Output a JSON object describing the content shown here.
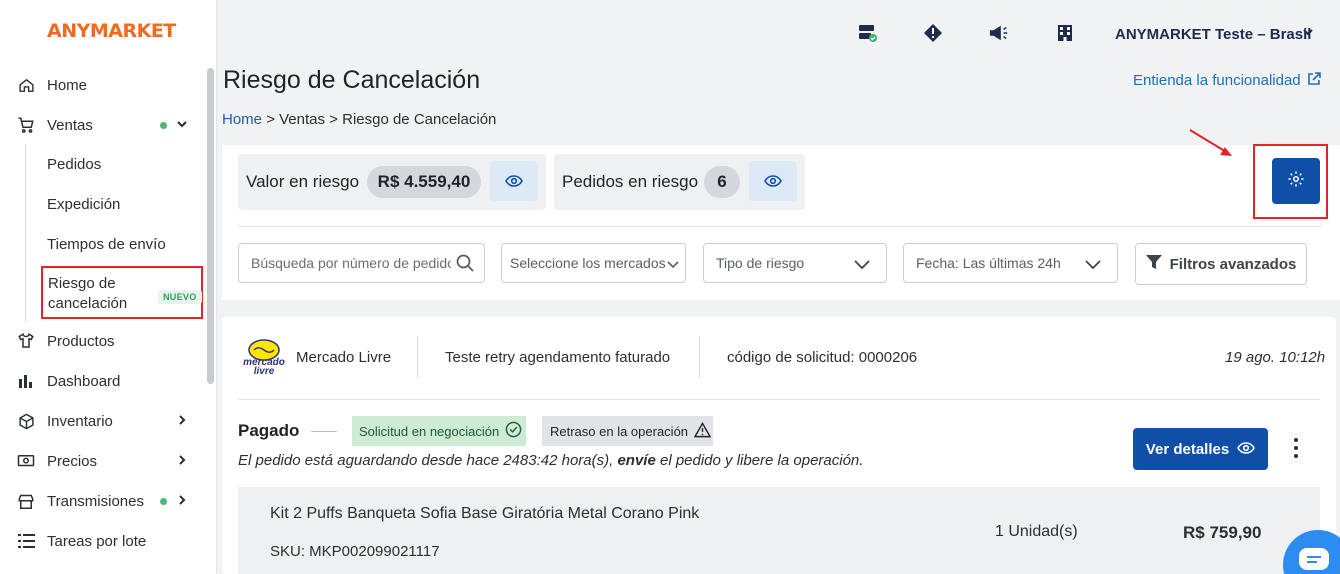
{
  "app": {
    "logo": "ANYMARKET"
  },
  "sidebar": {
    "items": [
      {
        "label": "Home",
        "icon": "home-icon"
      },
      {
        "label": "Ventas",
        "icon": "cart-icon",
        "expanded": true
      },
      {
        "label": "Productos",
        "icon": "shirt-icon"
      },
      {
        "label": "Dashboard",
        "icon": "bar-chart-icon"
      },
      {
        "label": "Inventario",
        "icon": "box-icon"
      },
      {
        "label": "Precios",
        "icon": "money-icon"
      },
      {
        "label": "Transmisiones",
        "icon": "store-icon"
      },
      {
        "label": "Tareas por lote",
        "icon": "list-icon"
      }
    ],
    "ventas_sub": [
      "Pedidos",
      "Expedición",
      "Tiempos de envío",
      "Riesgo de cancelación"
    ],
    "nuevo_badge": "NUEVO"
  },
  "topbar": {
    "icons": [
      "server-check-icon",
      "warning-diamond-icon",
      "megaphone-icon",
      "building-icon"
    ],
    "account": "ANYMARKET Teste – Brasil"
  },
  "header": {
    "title": "Riesgo de Cancelación",
    "help_link": "Entienda la funcionalidad",
    "breadcrumb": {
      "home": "Home",
      "sep": ">",
      "section": "Ventas",
      "current": "Riesgo de Cancelación"
    }
  },
  "summary": {
    "value_label": "Valor en riesgo",
    "value_amount": "R$ 4.559,40",
    "orders_label": "Pedidos en riesgo",
    "orders_count": "6"
  },
  "filters": {
    "search_placeholder": "Búsqueda por número de pedido",
    "marketplaces": "Seleccione los mercados",
    "risk_type": "Tipo de riesgo",
    "date": "Fecha: Las últimas 24h",
    "advanced": "Filtros avanzados"
  },
  "order": {
    "marketplace": "Mercado Livre",
    "marketplace_logo_text": "mercado livre",
    "account": "Teste retry agendamento faturado",
    "request_code": "código de solicitud: 0000206",
    "date": "19 ago. 10:12h",
    "status": "Pagado",
    "badge_negotiation": "Solicitud en negociación",
    "badge_delay": "Retraso en la operación",
    "message_pre": "El pedido está aguardando desde hace 2483:42 hora(s), ",
    "message_bold": "envíe",
    "message_post": " el pedido y libere la operación.",
    "details_button": "Ver detalles",
    "product": {
      "name": "Kit 2 Puffs Banqueta Sofia Base Giratória Metal Corano Pink",
      "sku": "SKU: MKP002099021117",
      "quantity": "1 Unidad(s)",
      "price": "R$ 759,90"
    }
  },
  "colors": {
    "brand": "#f26a21",
    "primary": "#0f4fa8",
    "annotation": "#e0262a"
  }
}
